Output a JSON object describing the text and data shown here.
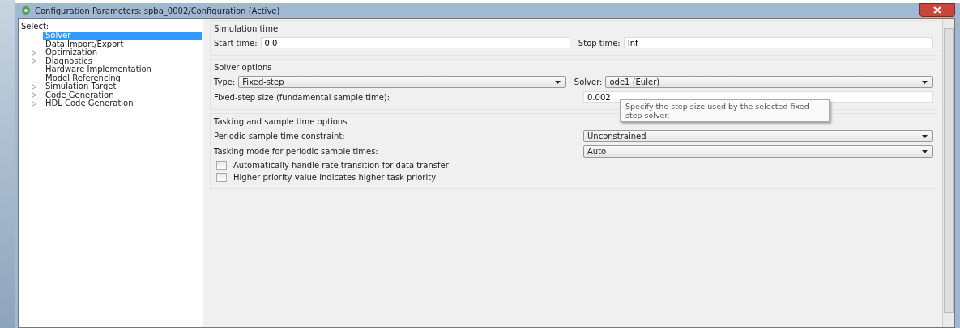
{
  "window": {
    "title": "Configuration Parameters: spba_0002/Configuration (Active)"
  },
  "sidebar": {
    "label": "Select:",
    "items": [
      {
        "label": "Solver",
        "expandable": false,
        "selected": true
      },
      {
        "label": "Data Import/Export",
        "expandable": false,
        "selected": false
      },
      {
        "label": "Optimization",
        "expandable": true,
        "selected": false
      },
      {
        "label": "Diagnostics",
        "expandable": true,
        "selected": false
      },
      {
        "label": "Hardware Implementation",
        "expandable": false,
        "selected": false
      },
      {
        "label": "Model Referencing",
        "expandable": false,
        "selected": false
      },
      {
        "label": "Simulation Target",
        "expandable": true,
        "selected": false
      },
      {
        "label": "Code Generation",
        "expandable": true,
        "selected": false
      },
      {
        "label": "HDL Code Generation",
        "expandable": true,
        "selected": false
      }
    ]
  },
  "simulation_time": {
    "title": "Simulation time",
    "start_label": "Start time:",
    "start_value": "0.0",
    "stop_label": "Stop time:",
    "stop_value": "Inf"
  },
  "solver_options": {
    "title": "Solver options",
    "type_label": "Type:",
    "type_value": "Fixed-step",
    "solver_label": "Solver:",
    "solver_value": "ode1 (Euler)",
    "step_label": "Fixed-step size (fundamental sample time):",
    "step_value": "0.002"
  },
  "tooltip": "Specify the step size used by the selected fixed-step solver.",
  "tasking": {
    "title": "Tasking and sample time options",
    "rows": [
      {
        "label": "Periodic sample time constraint:",
        "value": "Unconstrained"
      },
      {
        "label": "Tasking mode for periodic sample times:",
        "value": "Auto"
      }
    ],
    "checkboxes": [
      {
        "label": "Automatically handle rate transition for data transfer",
        "checked": false
      },
      {
        "label": "Higher priority value indicates higher task priority",
        "checked": false
      }
    ]
  }
}
